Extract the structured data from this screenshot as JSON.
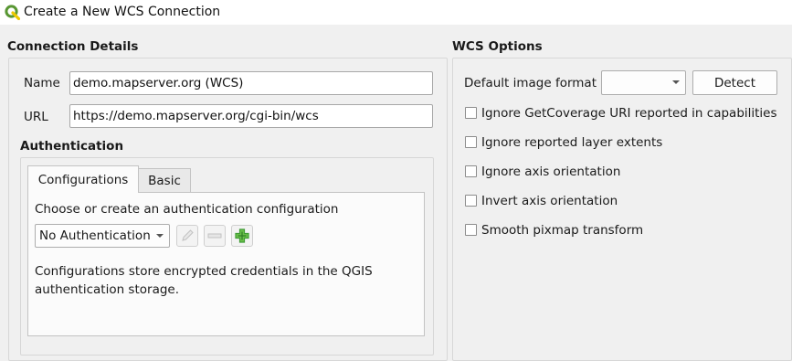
{
  "window": {
    "title": "Create a New WCS Connection"
  },
  "connection_details": {
    "title": "Connection Details",
    "name_label": "Name",
    "name_value": "demo.mapserver.org (WCS)",
    "url_label": "URL",
    "url_value": "https://demo.mapserver.org/cgi-bin/wcs"
  },
  "authentication": {
    "title": "Authentication",
    "tabs": [
      {
        "label": "Configurations",
        "active": true
      },
      {
        "label": "Basic",
        "active": false
      }
    ],
    "choose_label": "Choose or create an authentication configuration",
    "config_select_value": "No Authentication",
    "description": "Configurations store encrypted credentials in the QGIS authentication storage.",
    "icons": [
      "pencil-icon",
      "remove-icon",
      "add-icon"
    ]
  },
  "wcs_options": {
    "title": "WCS Options",
    "image_format_label": "Default image format",
    "image_format_value": "",
    "detect_label": "Detect",
    "checkboxes": [
      {
        "label": "Ignore GetCoverage URI reported in capabilities",
        "checked": false
      },
      {
        "label": "Ignore reported layer extents",
        "checked": false
      },
      {
        "label": "Ignore axis orientation",
        "checked": false
      },
      {
        "label": "Invert axis orientation",
        "checked": false
      },
      {
        "label": "Smooth pixmap transform",
        "checked": false
      }
    ]
  },
  "colors": {
    "logo_green": "#589632",
    "logo_yellow": "#eec900",
    "add_icon_green": "#3f9c35"
  }
}
